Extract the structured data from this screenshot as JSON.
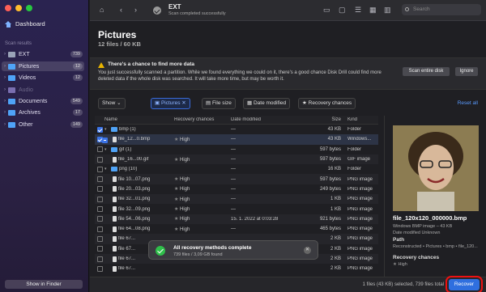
{
  "sidebar": {
    "dashboard_label": "Dashboard",
    "section_heading": "Scan results",
    "items": [
      {
        "label": "EXT",
        "count": "739",
        "icon": "drive-icon",
        "color": "#9aa3b8"
      },
      {
        "label": "Pictures",
        "count": "12",
        "icon": "pictures-icon",
        "color": "#4fa3f7"
      },
      {
        "label": "Videos",
        "count": "12",
        "icon": "videos-icon",
        "color": "#4fa3f7"
      },
      {
        "label": "Audio",
        "count": "",
        "icon": "audio-icon",
        "color": "#7a6fb0"
      },
      {
        "label": "Documents",
        "count": "549",
        "icon": "documents-icon",
        "color": "#4fa3f7"
      },
      {
        "label": "Archives",
        "count": "17",
        "icon": "archives-icon",
        "color": "#4fa3f7"
      },
      {
        "label": "Other",
        "count": "149",
        "icon": "other-icon",
        "color": "#4fa3f7"
      }
    ],
    "finder_button": "Show in Finder"
  },
  "topbar": {
    "title": "EXT",
    "subtitle": "Scan completed successfully",
    "search_placeholder": "Search"
  },
  "main": {
    "title": "Pictures",
    "subtitle": "12 files / 60 KB"
  },
  "banner": {
    "heading": "There's a chance to find more data",
    "text": "You just successfully scanned a partition. While we found everything we could on it, there's a good chance Disk Drill could find more deleted data if the whole disk was searched. It will take more time, but may be worth it.",
    "scan_button": "Scan entire disk",
    "ignore_button": "Ignore"
  },
  "filters": {
    "show": "Show",
    "pictures": "Pictures",
    "file_size": "File size",
    "date_modified": "Date modified",
    "recovery_chances": "Recovery chances",
    "reset": "Reset all"
  },
  "table": {
    "headers": {
      "name": "Name",
      "recovery": "Recovery chances",
      "date": "Date modified",
      "size": "Size",
      "kind": "Kind"
    },
    "rows": [
      {
        "type": "folder",
        "check": "on",
        "name": "bmp (1)",
        "recovery": "",
        "date": "—",
        "size": "43 KB",
        "kind": "Folder"
      },
      {
        "type": "file",
        "check": "on",
        "name": "file_12...0.bmp",
        "recovery": "High",
        "date": "—",
        "size": "43 KB",
        "kind": "Windows..."
      },
      {
        "type": "folder",
        "check": "off",
        "name": "gif (1)",
        "recovery": "",
        "date": "—",
        "size": "597 bytes",
        "kind": "Folder"
      },
      {
        "type": "file",
        "check": "off",
        "name": "file_16...00.gif",
        "recovery": "High",
        "date": "—",
        "size": "597 bytes",
        "kind": "GIF image"
      },
      {
        "type": "folder",
        "check": "off",
        "name": "png (10)",
        "recovery": "",
        "date": "—",
        "size": "16 KB",
        "kind": "Folder"
      },
      {
        "type": "file",
        "check": "off",
        "name": "file 10...07.png",
        "recovery": "High",
        "date": "—",
        "size": "597 bytes",
        "kind": "PNG image"
      },
      {
        "type": "file",
        "check": "off",
        "name": "file 20...03.png",
        "recovery": "High",
        "date": "—",
        "size": "249 bytes",
        "kind": "PNG image"
      },
      {
        "type": "file",
        "check": "off",
        "name": "file 32...01.png",
        "recovery": "High",
        "date": "—",
        "size": "1 KB",
        "kind": "PNG image"
      },
      {
        "type": "file",
        "check": "off",
        "name": "file 32...09.png",
        "recovery": "High",
        "date": "—",
        "size": "1 KB",
        "kind": "PNG image"
      },
      {
        "type": "file",
        "check": "off",
        "name": "file 54...06.png",
        "recovery": "High",
        "date": "15. 1. 2022 at 0:03:28",
        "size": "921 bytes",
        "kind": "PNG image"
      },
      {
        "type": "file",
        "check": "off",
        "name": "file 64...08.png",
        "recovery": "High",
        "date": "—",
        "size": "465 bytes",
        "kind": "PNG image"
      },
      {
        "type": "file",
        "check": "off",
        "name": "file 67...",
        "recovery": "",
        "date": "",
        "size": "2 KB",
        "kind": "PNG image"
      },
      {
        "type": "file",
        "check": "off",
        "name": "file 67...",
        "recovery": "",
        "date": "",
        "size": "2 KB",
        "kind": "PNG image"
      },
      {
        "type": "file",
        "check": "off",
        "name": "file 67...",
        "recovery": "",
        "date": "",
        "size": "2 KB",
        "kind": "PNG image"
      },
      {
        "type": "file",
        "check": "off",
        "name": "file 67...",
        "recovery": "",
        "date": "",
        "size": "2 KB",
        "kind": "PNG image"
      }
    ]
  },
  "toast": {
    "title": "All recovery methods complete",
    "subtitle": "739 files / 3,09 GB found"
  },
  "preview": {
    "filename": "file_120x120_000000.bmp",
    "meta1": "Windows BMP image – 43 KB",
    "meta2": "Date modified Unknown",
    "path_label": "Path",
    "path_value": "Reconstructed • Pictures • bmp • file_120...",
    "recovery_label": "Recovery chances",
    "recovery_value": "High"
  },
  "status": {
    "text": "1 files (43 KB) selected, 739 files total",
    "recover_button": "Recover"
  }
}
